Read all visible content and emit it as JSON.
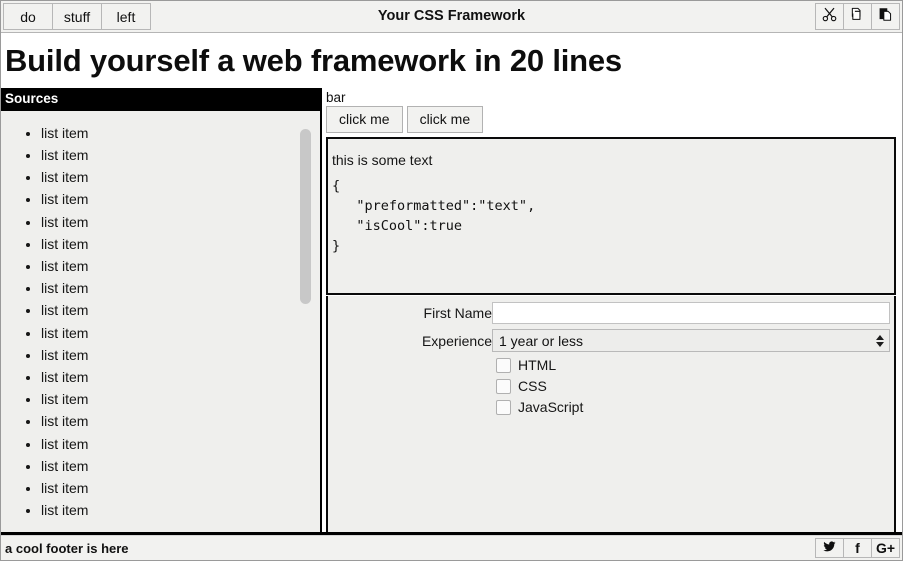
{
  "topbar": {
    "title": "Your CSS Framework",
    "nav": [
      {
        "label": "do",
        "name": "nav-do"
      },
      {
        "label": "stuff",
        "name": "nav-stuff"
      },
      {
        "label": "left",
        "name": "nav-left"
      }
    ],
    "tools": [
      {
        "icon": "cut-icon",
        "title": "Cut"
      },
      {
        "icon": "copy-icon",
        "title": "Copy"
      },
      {
        "icon": "paste-icon",
        "title": "Paste"
      }
    ]
  },
  "heading": "Build yourself a web framework in 20 lines",
  "sources": {
    "header": "Sources",
    "items": [
      "list item",
      "list item",
      "list item",
      "list item",
      "list item",
      "list item",
      "list item",
      "list item",
      "list item",
      "list item",
      "list item",
      "list item",
      "list item",
      "list item",
      "list item",
      "list item",
      "list item",
      "list item"
    ]
  },
  "main": {
    "bar_label": "bar",
    "tabs": [
      {
        "label": "click me"
      },
      {
        "label": "click me"
      }
    ],
    "panel": {
      "text": "this is some text",
      "pre": "{\n   \"preformatted\":\"text\",\n   \"isCool\":true\n}"
    },
    "form": {
      "first_name": {
        "label": "First Name",
        "value": "",
        "placeholder": ""
      },
      "experience": {
        "label": "Experience",
        "selected": "1 year or less"
      },
      "checkboxes": [
        {
          "label": "HTML",
          "checked": false
        },
        {
          "label": "CSS",
          "checked": false
        },
        {
          "label": "JavaScript",
          "checked": false
        }
      ]
    }
  },
  "footer": {
    "text": "a cool footer is here",
    "social": [
      {
        "icon": "twitter-icon",
        "glyph": ""
      },
      {
        "icon": "facebook-icon",
        "glyph": "f"
      },
      {
        "icon": "googleplus-icon",
        "glyph": "G+"
      }
    ]
  },
  "colors": {
    "panel_bg": "#efefed",
    "chrome_bg": "#f2f2f0",
    "header_bg": "#000000",
    "header_fg": "#ffffff",
    "border": "#000000"
  }
}
